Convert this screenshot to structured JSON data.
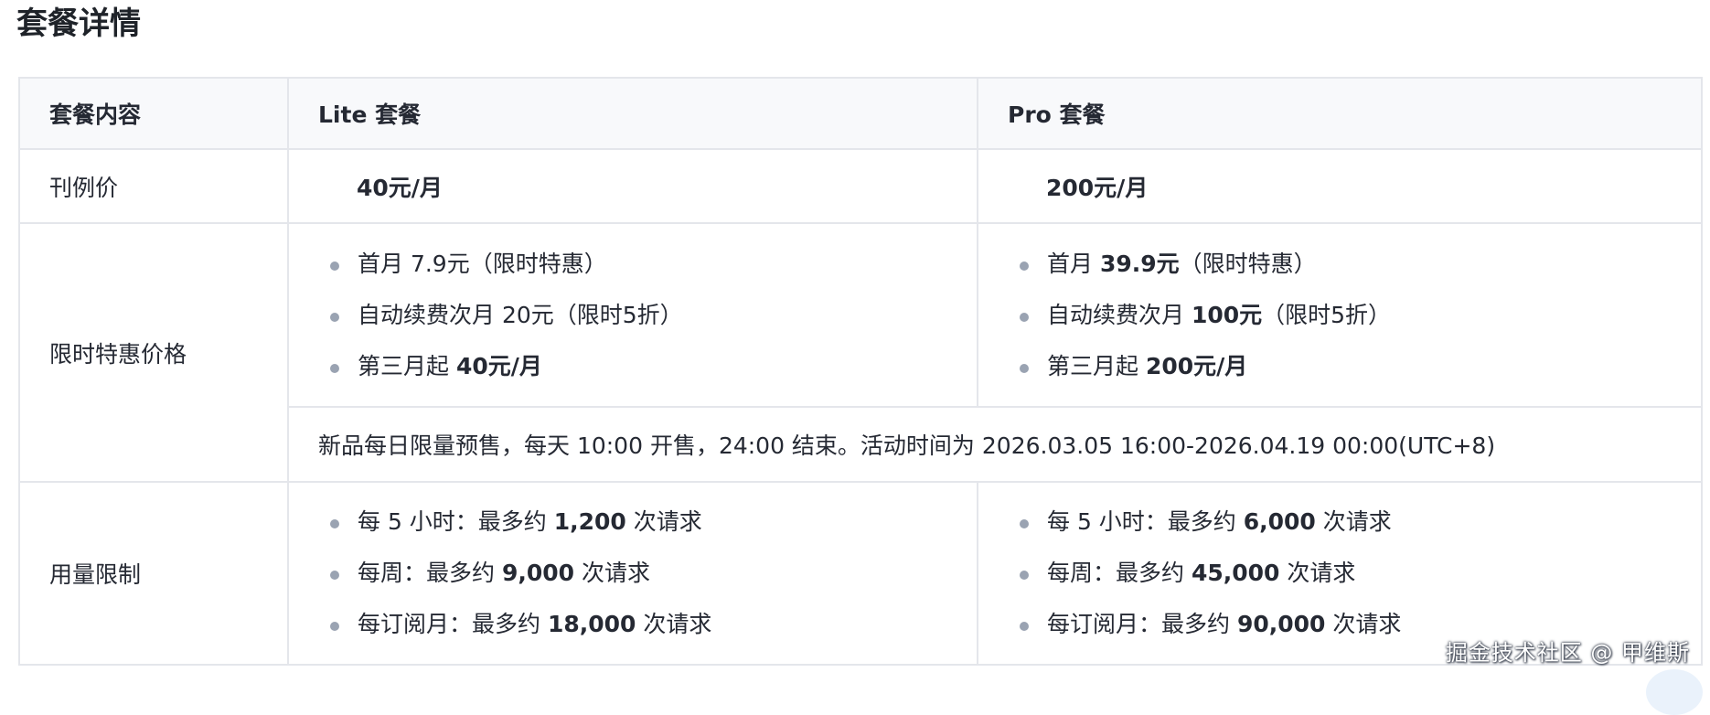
{
  "page": {
    "title": "套餐详情"
  },
  "table": {
    "headers": [
      "套餐内容",
      "Lite 套餐",
      "Pro 套餐"
    ],
    "regular_price": {
      "label": "刊例价",
      "lite": "40元/月",
      "pro": "200元/月"
    },
    "promo": {
      "label": "限时特惠价格",
      "lite": [
        {
          "prefix": "首月 7.9元（限时特惠）",
          "bold": "",
          "suffix": ""
        },
        {
          "prefix": "自动续费次月 20元（限时5折）",
          "bold": "",
          "suffix": ""
        },
        {
          "prefix": "第三月起 ",
          "bold": "40元/月",
          "suffix": ""
        }
      ],
      "pro": [
        {
          "prefix": "首月 ",
          "bold": "39.9元",
          "suffix": "（限时特惠）"
        },
        {
          "prefix": "自动续费次月 ",
          "bold": "100元",
          "suffix": "（限时5折）"
        },
        {
          "prefix": "第三月起 ",
          "bold": "200元/月",
          "suffix": ""
        }
      ],
      "note": "新品每日限量预售，每天 10:00 开售，24:00 结束。活动时间为 2026.03.05 16:00-2026.04.19 00:00(UTC+8)"
    },
    "usage": {
      "label": "用量限制",
      "lite": [
        {
          "prefix": "每 5 小时：最多约 ",
          "bold": "1,200",
          "suffix": " 次请求"
        },
        {
          "prefix": "每周：最多约 ",
          "bold": "9,000",
          "suffix": " 次请求"
        },
        {
          "prefix": "每订阅月：最多约 ",
          "bold": "18,000",
          "suffix": " 次请求"
        }
      ],
      "pro": [
        {
          "prefix": "每 5 小时：最多约 ",
          "bold": "6,000",
          "suffix": " 次请求"
        },
        {
          "prefix": "每周：最多约 ",
          "bold": "45,000",
          "suffix": " 次请求"
        },
        {
          "prefix": "每订阅月：最多约 ",
          "bold": "90,000",
          "suffix": " 次请求"
        }
      ]
    }
  },
  "watermark": "掘金技术社区 @ 甲维斯"
}
